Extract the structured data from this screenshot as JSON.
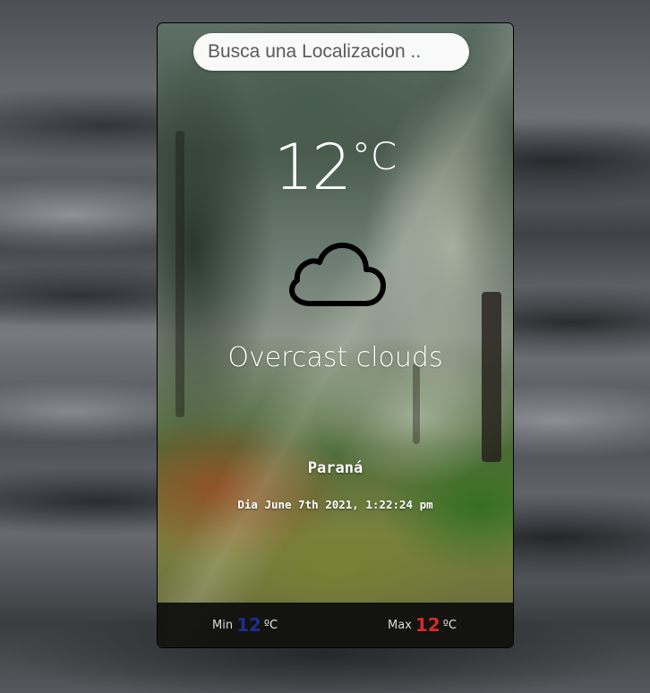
{
  "search": {
    "placeholder": "Busca una Localizacion .."
  },
  "weather": {
    "temperature": "12",
    "temperature_unit": "°C",
    "icon": "cloud-icon",
    "description": "Overcast clouds",
    "city": "Paraná",
    "datetime": "Dia June 7th 2021, 1:22:24 pm"
  },
  "footer": {
    "min_label": "Min",
    "min_value": "12",
    "min_unit": "ºC",
    "max_label": "Max",
    "max_value": "12",
    "max_unit": "ºC"
  },
  "colors": {
    "min_value": "#1c2e8f",
    "max_value": "#d52a2a"
  }
}
